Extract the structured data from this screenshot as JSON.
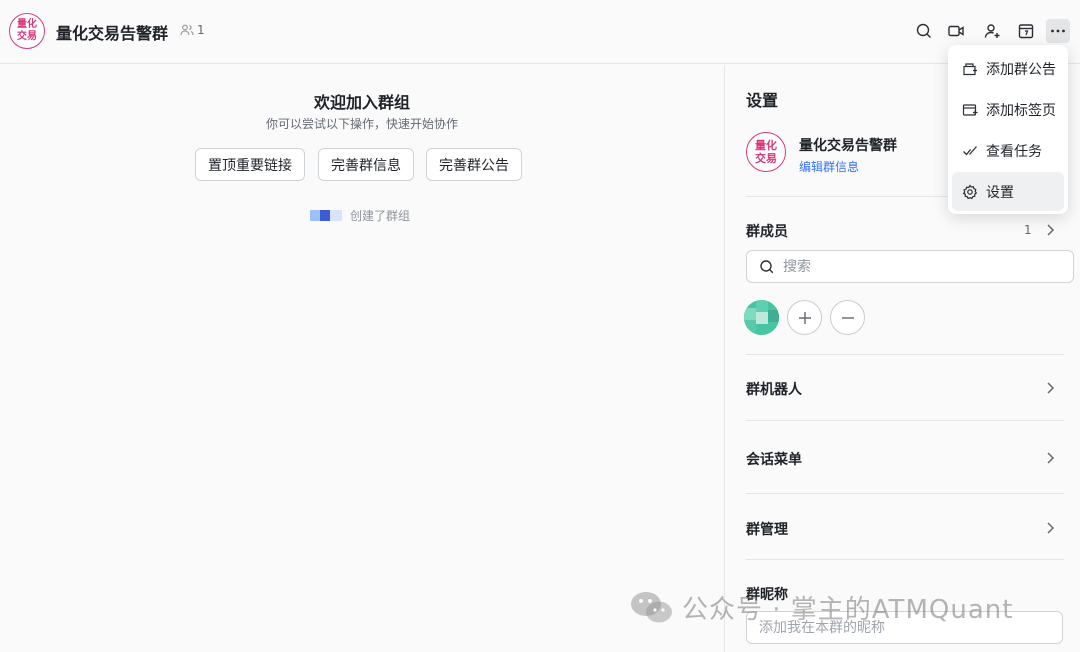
{
  "header": {
    "avatar_text": "量化交易",
    "title": "量化交易告警群",
    "member_count": "1"
  },
  "chat": {
    "welcome_title": "欢迎加入群组",
    "welcome_subtitle": "你可以尝试以下操作，快速开始协作",
    "actions": [
      "置顶重要链接",
      "完善群信息",
      "完善群公告"
    ],
    "system_message": "创建了群组"
  },
  "settings": {
    "title": "设置",
    "group_avatar_text": "量化交易",
    "group_name": "量化交易告警群",
    "edit_link": "编辑群信息",
    "members_label": "群成员",
    "members_count": "1",
    "search_placeholder": "搜索",
    "bots_label": "群机器人",
    "menu_label": "会话菜单",
    "manage_label": "群管理",
    "nickname_label": "群昵称",
    "nickname_placeholder": "添加我在本群的昵称"
  },
  "more_menu": {
    "items": [
      "添加群公告",
      "添加标签页",
      "查看任务",
      "设置"
    ]
  },
  "watermark": {
    "text": "公众号 · 掌主的ATMQuant"
  },
  "colors": {
    "accent_pink": "#d6397c",
    "link_blue": "#3370ff",
    "divider": "#e5e6eb"
  },
  "icons": {
    "header": [
      "search-icon",
      "video-icon",
      "add-member-icon",
      "calendar-icon",
      "more-icon"
    ],
    "menu": [
      "announcement-icon",
      "add-tab-icon",
      "task-check-icon",
      "gear-icon"
    ]
  }
}
